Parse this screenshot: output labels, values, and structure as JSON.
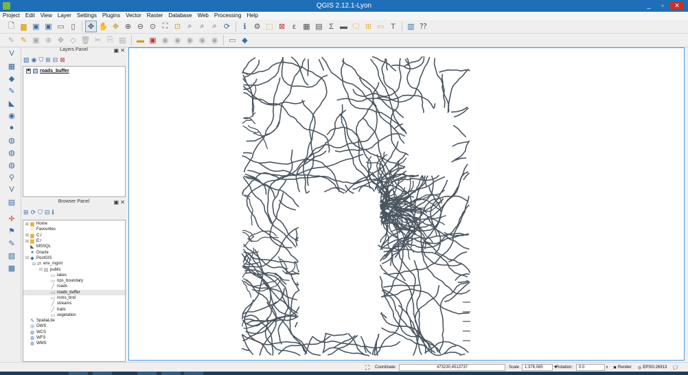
{
  "window": {
    "title": "QGIS 2.12.1-Lyon",
    "min": "_",
    "max": "▫",
    "close": "✕"
  },
  "menu": [
    "Project",
    "Edit",
    "View",
    "Layer",
    "Settings",
    "Plugins",
    "Vector",
    "Raster",
    "Database",
    "Web",
    "Processing",
    "Help"
  ],
  "layers_panel": {
    "title": "Layers Panel",
    "float_btn": "▣",
    "close_btn": "✕",
    "layers": [
      {
        "name": "roads_buffer",
        "checked": "✖",
        "color": "#a7c3e8"
      }
    ]
  },
  "browser_panel": {
    "title": "Browser Panel",
    "float_btn": "▣",
    "close_btn": "✕",
    "items": [
      {
        "label": "Home",
        "depth": 0,
        "expander": "⊞",
        "icon": "folder-icon",
        "glyph": "▆",
        "color": "#e2b33c"
      },
      {
        "label": "Favourites",
        "depth": 0,
        "expander": "",
        "icon": "star-icon",
        "glyph": "☆",
        "color": "#c9a227"
      },
      {
        "label": "C:/",
        "depth": 0,
        "expander": "⊞",
        "icon": "folder-icon",
        "glyph": "▆",
        "color": "#e2b33c"
      },
      {
        "label": "E:/",
        "depth": 0,
        "expander": "⊞",
        "icon": "folder-icon",
        "glyph": "▆",
        "color": "#e2b33c"
      },
      {
        "label": "MSSQL",
        "depth": 0,
        "expander": "",
        "icon": "mssql-icon",
        "glyph": "◣",
        "color": "#555555"
      },
      {
        "label": "Oracle",
        "depth": 0,
        "expander": "",
        "icon": "oracle-icon",
        "glyph": "●",
        "color": "#3a6ea5"
      },
      {
        "label": "PostGIS",
        "depth": 0,
        "expander": "⊟",
        "icon": "postgis-icon",
        "glyph": "◆",
        "color": "#3a6ea5"
      },
      {
        "label": "env_mgmt",
        "depth": 1,
        "expander": "⊟",
        "icon": "connection-icon",
        "glyph": "⇄",
        "color": "#555555"
      },
      {
        "label": "public",
        "depth": 2,
        "expander": "⊟",
        "icon": "schema-icon",
        "glyph": "▤",
        "color": "#777777"
      },
      {
        "label": "lakes",
        "depth": 3,
        "expander": "",
        "icon": "polygon-layer-icon",
        "glyph": "▭",
        "color": "#777777"
      },
      {
        "label": "nps_boundary",
        "depth": 3,
        "expander": "",
        "icon": "polygon-layer-icon",
        "glyph": "▭",
        "color": "#777777"
      },
      {
        "label": "roads",
        "depth": 3,
        "expander": "",
        "icon": "line-layer-icon",
        "glyph": "╱",
        "color": "#777777"
      },
      {
        "label": "roads_buffer",
        "depth": 3,
        "expander": "",
        "icon": "polygon-layer-icon",
        "glyph": "▭",
        "color": "#5a7fb0",
        "selected": true
      },
      {
        "label": "romo_bnd",
        "depth": 3,
        "expander": "",
        "icon": "polygon-layer-icon",
        "glyph": "▭",
        "color": "#777777"
      },
      {
        "label": "streams",
        "depth": 3,
        "expander": "",
        "icon": "line-layer-icon",
        "glyph": "╱",
        "color": "#777777"
      },
      {
        "label": "trails",
        "depth": 3,
        "expander": "",
        "icon": "line-layer-icon",
        "glyph": "╱",
        "color": "#777777"
      },
      {
        "label": "vegetation",
        "depth": 3,
        "expander": "",
        "icon": "polygon-layer-icon",
        "glyph": "▭",
        "color": "#777777"
      },
      {
        "label": "SpatiaLite",
        "depth": 0,
        "expander": "",
        "icon": "spatialite-icon",
        "glyph": "✎",
        "color": "#3a6ea5"
      },
      {
        "label": "OWS",
        "depth": 0,
        "expander": "",
        "icon": "ows-icon",
        "glyph": "◎",
        "color": "#3a6ea5"
      },
      {
        "label": "WCS",
        "depth": 0,
        "expander": "",
        "icon": "wcs-icon",
        "glyph": "◍",
        "color": "#3a6ea5"
      },
      {
        "label": "WFS",
        "depth": 0,
        "expander": "",
        "icon": "wfs-icon",
        "glyph": "◍",
        "color": "#3a6ea5"
      },
      {
        "label": "WMS",
        "depth": 0,
        "expander": "",
        "icon": "wms-icon",
        "glyph": "◍",
        "color": "#3a6ea5"
      }
    ]
  },
  "status": {
    "coordinate_label": "Coordinate:",
    "coordinate": "473230,4513737",
    "scale_label": "Scale",
    "scale": "1:376,085",
    "rotation_label": "Rotation:",
    "rotation": "0.0",
    "render_label": "Render",
    "render_check": "✖",
    "crs": "EPSG:26913",
    "messages_glyph": "💬"
  },
  "colors": {
    "road_stroke": "#4a5560",
    "map_border": "#4d9be0",
    "title_bar": "#1f6fb8"
  }
}
